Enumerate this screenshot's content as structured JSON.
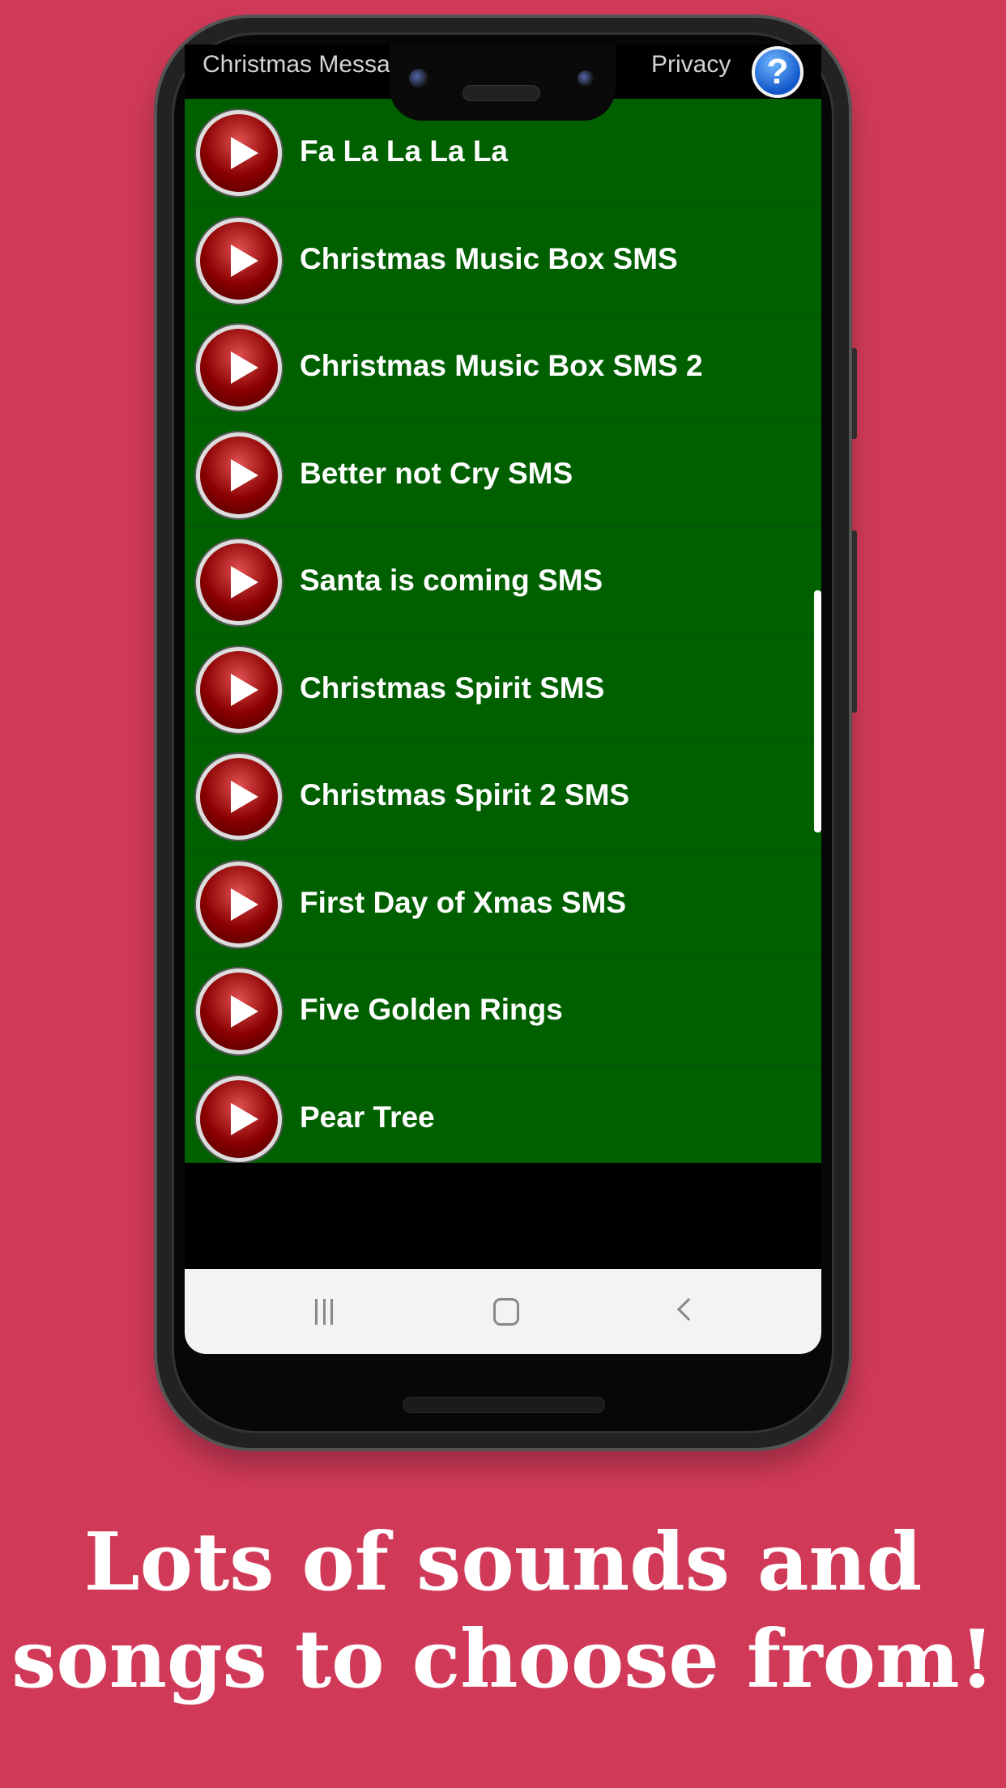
{
  "status_bar": {
    "title": "Christmas Messa",
    "privacy": "Privacy",
    "help_icon": "question-mark-icon"
  },
  "list": {
    "items": [
      {
        "label": "Fa La La La La",
        "icon": "play-icon"
      },
      {
        "label": "Christmas Music Box SMS",
        "icon": "play-icon"
      },
      {
        "label": "Christmas Music Box SMS 2",
        "icon": "play-icon"
      },
      {
        "label": "Better not Cry SMS",
        "icon": "play-icon"
      },
      {
        "label": "Santa is coming SMS",
        "icon": "play-icon"
      },
      {
        "label": "Christmas Spirit SMS",
        "icon": "play-icon"
      },
      {
        "label": "Christmas Spirit 2 SMS",
        "icon": "play-icon"
      },
      {
        "label": "First Day of Xmas SMS",
        "icon": "play-icon"
      },
      {
        "label": "Five Golden Rings",
        "icon": "play-icon"
      },
      {
        "label": "Pear Tree",
        "icon": "play-icon"
      }
    ]
  },
  "headline": {
    "line1": "Lots of sounds and",
    "line2": "songs to choose from!"
  },
  "colors": {
    "background": "#d03a58",
    "list_bg": "#006000",
    "play_button": "#a00000"
  }
}
